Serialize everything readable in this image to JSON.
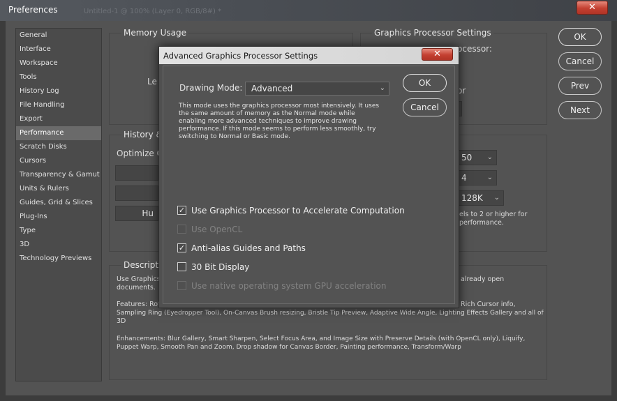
{
  "window": {
    "title": "Preferences",
    "ghost_title": "Untitled-1 @ 100% (Layer 0, RGB/8#) *",
    "close_glyph": "✕"
  },
  "sidebar": {
    "items": [
      {
        "label": "General"
      },
      {
        "label": "Interface"
      },
      {
        "label": "Workspace"
      },
      {
        "label": "Tools"
      },
      {
        "label": "History Log"
      },
      {
        "label": "File Handling"
      },
      {
        "label": "Export"
      },
      {
        "label": "Performance",
        "selected": true
      },
      {
        "label": "Scratch Disks"
      },
      {
        "label": "Cursors"
      },
      {
        "label": "Transparency & Gamut"
      },
      {
        "label": "Units & Rulers"
      },
      {
        "label": "Guides, Grid & Slices"
      },
      {
        "label": "Plug-Ins"
      },
      {
        "label": "Type"
      },
      {
        "label": "3D"
      },
      {
        "label": "Technology Previews"
      }
    ]
  },
  "background": {
    "memory_title": "Memory Usage",
    "memory_partial": "Le",
    "gpu_title": "Graphics Processor Settings",
    "gpu_partial_1": "ocessor:",
    "gpu_partial_2": "or",
    "history_title": "History &",
    "optimize_partial": "Optimize C",
    "hu_partial": "Hu",
    "history_states": "50",
    "cache_levels": "4",
    "cache_tile": "128K",
    "cache_hint_1": "els to 2 or higher for",
    "cache_hint_2": "performance.",
    "desc_title": "Descripti",
    "desc_line1_left": "Use Graphics",
    "desc_line1_right": "already open",
    "desc_line2": "documents.",
    "features_left": "Features: Rot",
    "features_right": "Rich Cursor info,",
    "features_line2": "Sampling Ring (Eyedropper Tool), On-Canvas Brush resizing, Bristle Tip Preview, Adaptive Wide Angle, Lighting Effects Gallery and all of",
    "features_line3": "3D",
    "enhancements_line1": "Enhancements: Blur Gallery, Smart Sharpen, Select Focus Area, and Image Size with Preserve Details (with OpenCL only), Liquify,",
    "enhancements_line2": "Puppet Warp, Smooth Pan and Zoom, Drop shadow for Canvas Border, Painting performance, Transform/Warp"
  },
  "buttons": {
    "ok": "OK",
    "cancel": "Cancel",
    "prev": "Prev",
    "next": "Next"
  },
  "dialog": {
    "title": "Advanced Graphics Processor Settings",
    "drawing_mode_label": "Drawing Mode:",
    "drawing_mode_value": "Advanced",
    "description": "This mode uses the graphics processor most intensively.  It uses\nthe same amount of memory as the Normal mode while\nenabling more advanced techniques to improve drawing\nperformance.  If this mode seems to perform less smoothly, try\nswitching to Normal or Basic mode.",
    "ok_label": "OK",
    "cancel_label": "Cancel",
    "checkboxes": [
      {
        "label": "Use Graphics Processor to Accelerate Computation",
        "checked": true,
        "enabled": true
      },
      {
        "label": "Use OpenCL",
        "checked": false,
        "enabled": false
      },
      {
        "label": "Anti-alias Guides and Paths",
        "checked": true,
        "enabled": true
      },
      {
        "label": "30 Bit Display",
        "checked": false,
        "enabled": true
      },
      {
        "label": "Use native operating system GPU acceleration",
        "checked": false,
        "enabled": false
      }
    ]
  },
  "icons": {
    "chevron_down": "chevron-down-icon",
    "checkmark": "checkmark-icon",
    "close": "close-icon"
  }
}
